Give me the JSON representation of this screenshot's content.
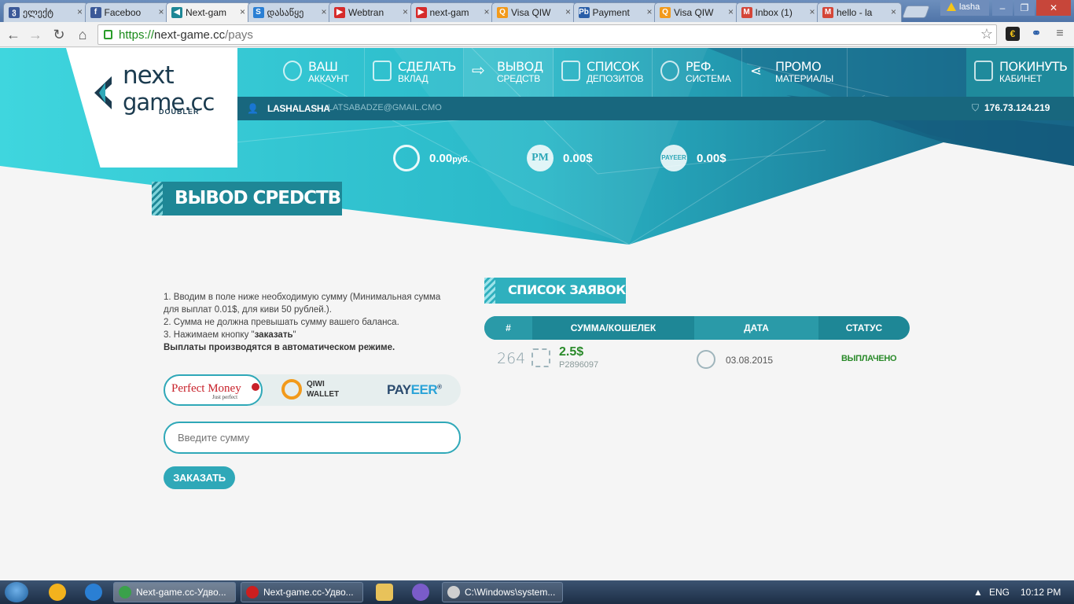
{
  "browser": {
    "tabs": [
      {
        "title": "ელექტ",
        "color": "#3b5998",
        "glyph": "ვ"
      },
      {
        "title": "Faceboo",
        "color": "#3b5998",
        "glyph": "f"
      },
      {
        "title": "Next-gam",
        "color": "#1e8796",
        "glyph": "◀",
        "active": true
      },
      {
        "title": "დასაწყე",
        "color": "#2a7fd4",
        "glyph": "S"
      },
      {
        "title": "Webtran",
        "color": "#d62b2b",
        "glyph": "▶"
      },
      {
        "title": "next-gam",
        "color": "#d62b2b",
        "glyph": "▶"
      },
      {
        "title": "Visa QIW",
        "color": "#f29a1b",
        "glyph": "Q"
      },
      {
        "title": "Payment",
        "color": "#2a5ea8",
        "glyph": "Pb"
      },
      {
        "title": "Visa QIW",
        "color": "#f29a1b",
        "glyph": "Q"
      },
      {
        "title": "Inbox (1)",
        "color": "#d44638",
        "glyph": "M"
      },
      {
        "title": "hello - la",
        "color": "#d44638",
        "glyph": "M"
      }
    ],
    "profile_name": "lasha",
    "url_https": "https://",
    "url_host": "next-game.cc",
    "url_path": "/pays"
  },
  "site": {
    "logo_line1": "next",
    "logo_line2": "game.cc",
    "logo_sub": "DOUBLER",
    "menu": [
      {
        "line1": "ВАШ",
        "line2": "АККАУНТ"
      },
      {
        "line1": "СДЕЛАТЬ",
        "line2": "ВКЛАД"
      },
      {
        "line1": "ВЫВОД",
        "line2": "СРЕДСТВ"
      },
      {
        "line1": "СПИСОК",
        "line2": "ДЕПОЗИТОВ"
      },
      {
        "line1": "РЕФ.",
        "line2": "СИСТЕМА"
      },
      {
        "line1": "ПРОМО",
        "line2": "МАТЕРИАЛЫ"
      }
    ],
    "exit": {
      "line1": "ПОКИНУТЬ",
      "line2": "КАБИНЕТ"
    },
    "user": {
      "name": "LASHALASHA",
      "email": "LATSABADZE@GMAIL.CMO",
      "ip": "176.73.124.219"
    },
    "balances": [
      {
        "icon": "Q",
        "value": "0.00",
        "unit": "руб."
      },
      {
        "icon": "PM",
        "value": "0.00$",
        "unit": ""
      },
      {
        "icon": "PAYEER",
        "value": "0.00$",
        "unit": ""
      }
    ],
    "page_title": "ВЫВОD СРЕDСТВ",
    "instructions": {
      "l1": "1. Вводим в поле ниже необходимую сумму (Минимальная сумма для выплат 0.01$, для киви 50 рублей.).",
      "l2": "2. Сумма не должна превышать сумму вашего баланса.",
      "l3_pre": "3. Нажимаем кнопку \"",
      "l3_bold": "заказать",
      "l3_post": "\"",
      "l4": "Выплаты производятся в автоматическом режиме."
    },
    "pay_systems": {
      "pm": "Perfect Money",
      "pm_sub": "Just perfect",
      "qiwi_1": "QIWI",
      "qiwi_2": "WALLET",
      "payeer_a": "PAY",
      "payeer_b": "EER",
      "payeer_reg": "®"
    },
    "amount_placeholder": "Введите сумму",
    "order_button": "ЗАКАЗАТЬ",
    "list_title": "СПИСОК ЗАЯВОК",
    "table": {
      "headers": [
        "#",
        "СУММА/КОШЕЛЕК",
        "ДАТА",
        "СТАТУС"
      ],
      "rows": [
        {
          "id": "264",
          "sum": "2.5$",
          "wallet": "P2896097",
          "date": "03.08.2015",
          "status": "ВЫПЛАЧЕНО"
        }
      ]
    }
  },
  "taskbar": {
    "tasks": [
      {
        "label": "Next-game.cc-Удво...",
        "color": "#3aa14b",
        "active": true
      },
      {
        "label": "Next-game.cc-Удво...",
        "color": "#cc1f1f"
      },
      {
        "label": "C:\\Windows\\system...",
        "color": "#cfcfcf"
      }
    ],
    "lang": "ENG",
    "time": "10:12 PM"
  },
  "colors": {
    "accent": "#2fa8b8",
    "accent_dark": "#1e8796",
    "success": "#2a8a2a"
  }
}
